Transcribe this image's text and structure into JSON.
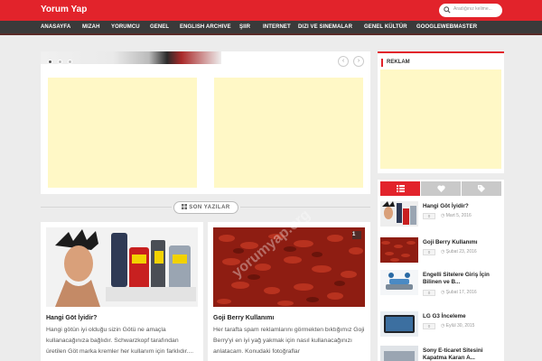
{
  "header": {
    "logo": "Yorum Yap",
    "search_placeholder": "Aradığınız kelime..."
  },
  "nav": [
    "ANASAYFA",
    "MIZAH",
    "YORUMCU",
    "GENEL",
    "ENGLISH ARCHIVE",
    "ŞIIR",
    "INTERNET",
    "DIZI VE SINEMALAR",
    "GENEL KÜLTÜR",
    "GOOGLEWEBMASTER"
  ],
  "slider": {
    "prev_glyph": "‹",
    "next_glyph": "›"
  },
  "section": {
    "label": "SON YAZILAR"
  },
  "posts": [
    {
      "title": "Hangi Göt İyidir?",
      "excerpt": "Hangi götün iyi olduğu sizin Götü ne amaçla kullanacağınıza bağlıdır. Schwarzkopf tarafından üretilen Göt marka kremler her kullanım için farklıdır...."
    },
    {
      "title": "Goji Berry Kullanımı",
      "excerpt": "Her tarafta spam reklamlarını görmekten bıktığımız Goji Berry'yi en iyi yağ yakmak için nasıl kullanacağınızı anlatacam. Konudaki fotoğraflar",
      "count": "1",
      "watermark": "yorumyap.org"
    }
  ],
  "sidebar": {
    "reklam_title": "REKLAM",
    "items": [
      {
        "title": "Hangi Göt İyidir?",
        "chip": "0",
        "date": "Mart 5, 2016"
      },
      {
        "title": "Goji Berry Kullanımı",
        "chip": "0",
        "date": "Şubat 23, 2016"
      },
      {
        "title": "Engelli Sitelere Giriş İçin",
        "title2": "Bilinen ve B...",
        "chip": "0",
        "date": "Şubat 17, 2016"
      },
      {
        "title": "LG G3 İnceleme",
        "chip": "0",
        "date": "Eylül 30, 2015"
      },
      {
        "title": "Sony E-ticaret Sitesini",
        "title2": "Kapatma Kararı A...",
        "chip": "0",
        "date": ""
      }
    ]
  },
  "colors": {
    "brand": "#e2232b",
    "nav": "#3a3a3a",
    "ad": "#fff8c6"
  }
}
